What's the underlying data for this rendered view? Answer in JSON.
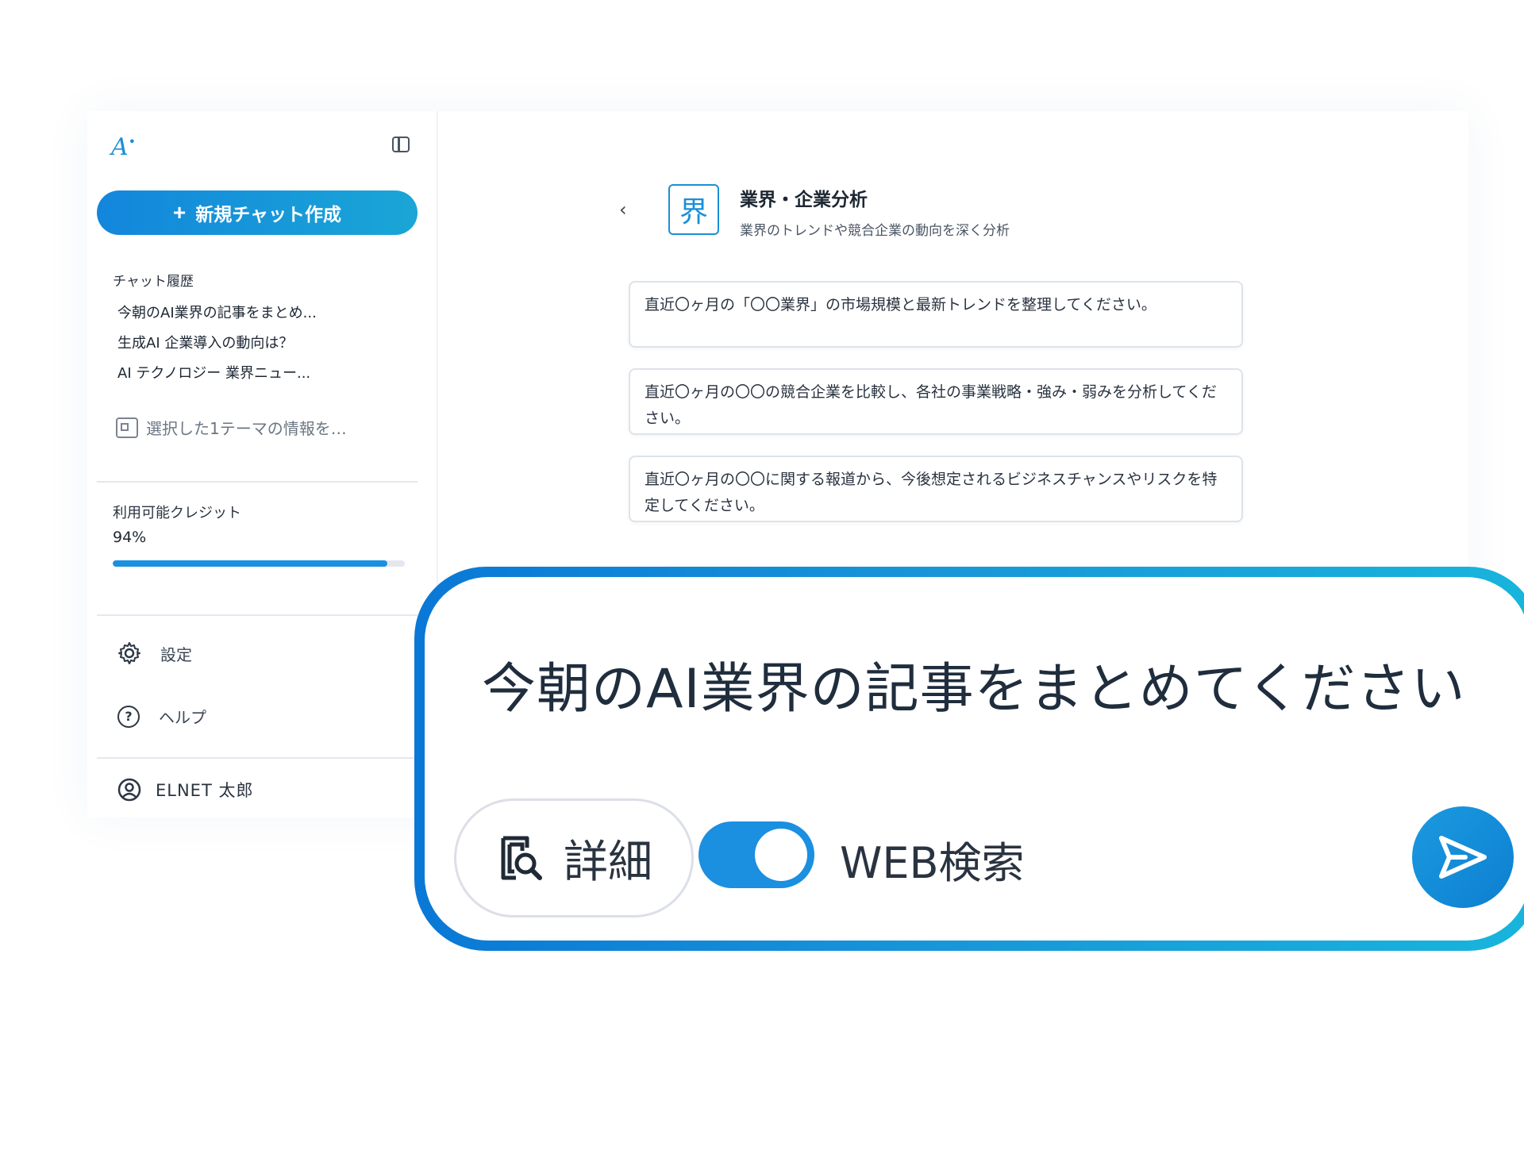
{
  "sidebar": {
    "logo": "A",
    "new_chat_label": "新規チャット作成",
    "history_title": "チャット履歴",
    "history_items": [
      "今朝のAI業界の記事をまとめ...",
      "生成AI 企業導入の動向は？",
      "AI テクノロジー 業界ニュー..."
    ],
    "theme_item": "選択した1テーマの情報を…",
    "credit_label": "利用可能クレジット",
    "credit_value": "94%",
    "credit_fraction": 0.94,
    "settings_label": "設定",
    "help_label": "ヘルプ",
    "user_name": "ELNET 太郎"
  },
  "main": {
    "category_icon_char": "界",
    "category_title": "業界・企業分析",
    "category_desc": "業界のトレンドや競合企業の動向を深く分析",
    "prompts": [
      "直近〇ヶ月の「〇〇業界」の市場規模と最新トレンドを整理してください。",
      "直近〇ヶ月の〇〇の競合企業を比較し、各社の事業戦略・強み・弱みを分析してください。",
      "直近〇ヶ月の〇〇に関する報道から、今後想定されるビジネスチャンスやリスクを特定してください。"
    ]
  },
  "input": {
    "text": "今朝のAI業界の記事をまとめてください",
    "detail_label": "詳細",
    "web_search_label": "WEB検索",
    "web_search_on": true
  },
  "colors": {
    "accent": "#1b8fe0",
    "accent_light": "#18b5dc"
  }
}
